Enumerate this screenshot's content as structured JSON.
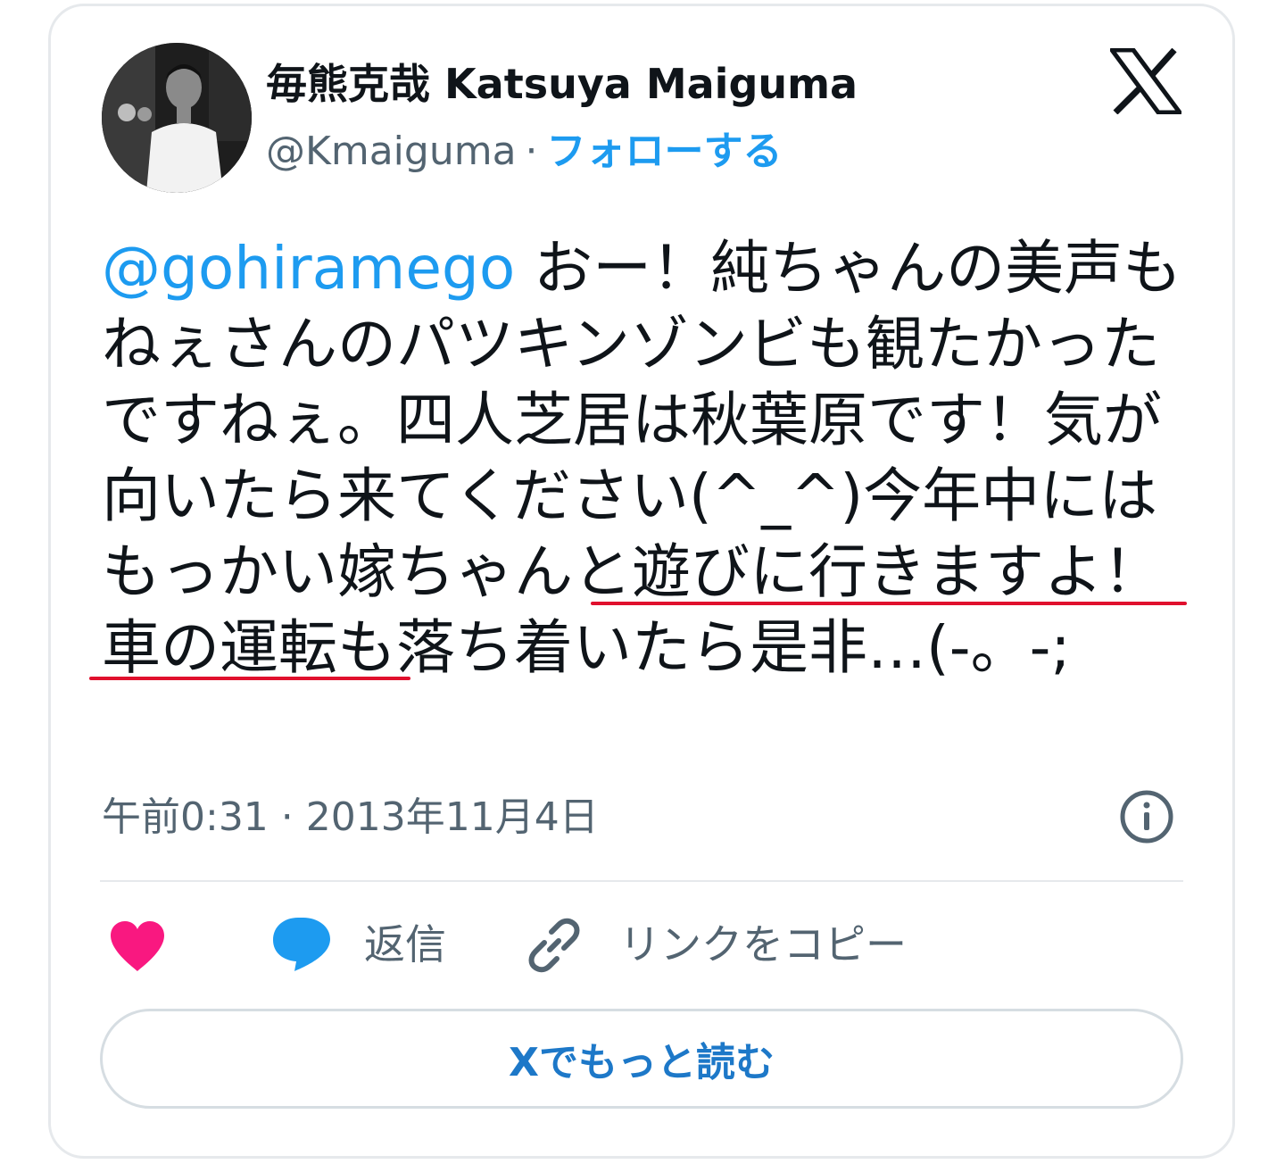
{
  "author": {
    "name": "毎熊克哉 Katsuya Maiguma",
    "handle": "@Kmaiguma",
    "separator": "·",
    "follow_label": "フォローする"
  },
  "tweet": {
    "mention": "@gohiramego",
    "body": " おー！純ちゃんの美声もねぇさんのパツキンゾンビも観たかったですねぇ。四人芝居は秋葉原です！気が向いたら来てください(^_^)今年中にはもっかい嫁ちゃんと遊びに行きますよ！車の運転も落ち着いたら是非…(-。-;",
    "timestamp": "午前0:31 · 2013年11月4日"
  },
  "actions": {
    "reply_label": "返信",
    "copy_link_label": "リンクをコピー"
  },
  "read_more_label": "Xでもっと読む",
  "colors": {
    "accent": "#1d9bf0",
    "heart": "#f91880",
    "underline": "#e0102d",
    "secondary_text": "#536471"
  },
  "icons": [
    "x-logo-icon",
    "info-icon",
    "heart-icon",
    "reply-bubble-icon",
    "link-icon"
  ]
}
